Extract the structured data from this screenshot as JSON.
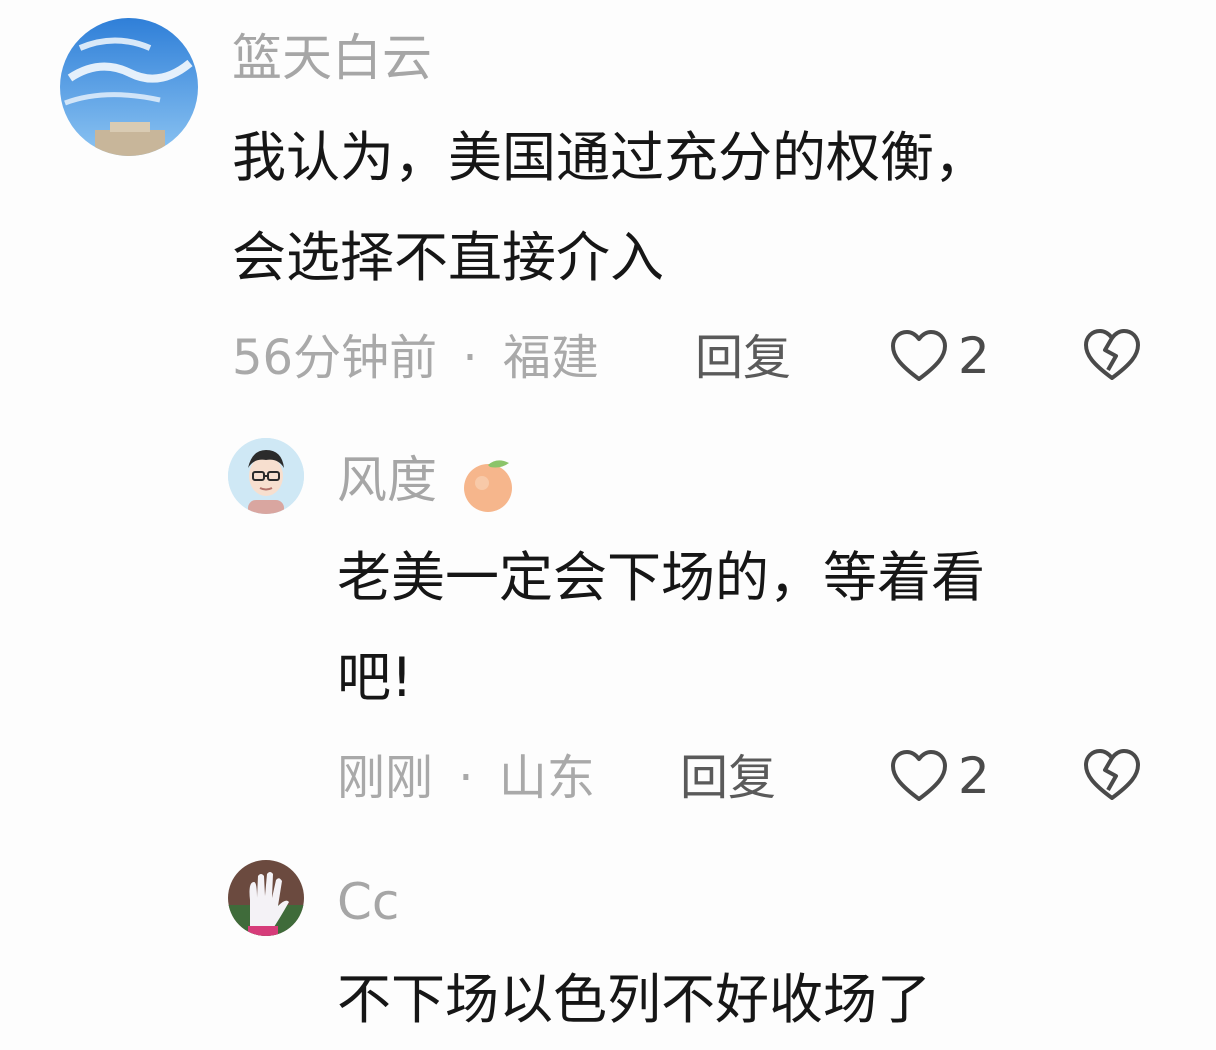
{
  "comments": [
    {
      "username": "篮天白云",
      "text_lines": [
        "我认为，美国通过充分的权衡，",
        "会选择不直接介入"
      ],
      "time": "56分钟前",
      "location": "福建",
      "reply_label": "回复",
      "likes": "2"
    },
    {
      "username": "风度",
      "text_lines": [
        "老美一定会下场的，等着看",
        "吧!"
      ],
      "time": "刚刚",
      "location": "山东",
      "reply_label": "回复",
      "likes": "2"
    },
    {
      "username": "Cc",
      "text_lines": [
        "不下场以色列不好收场了"
      ]
    }
  ],
  "separator": "·",
  "icons": {
    "like": "heart-outline-icon",
    "dislike": "broken-heart-icon",
    "badge": "orange-fruit-icon"
  },
  "colors": {
    "username": "#a6a6a6",
    "body": "#161616",
    "meta": "#a9a9a9",
    "reply": "#5a5a5a"
  }
}
